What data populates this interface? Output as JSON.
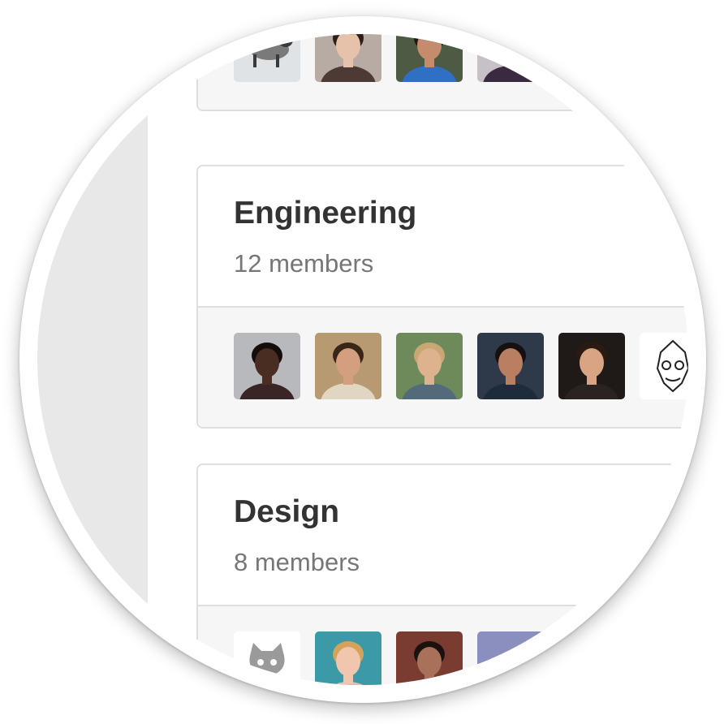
{
  "groups": [
    {
      "name": "",
      "members_label": "",
      "avatars": [
        {
          "icon": "cat-photo-avatar",
          "bg": "#dfe3e6",
          "skin": "#7a7a7a",
          "hair": "#3a3a3a",
          "shirt": "#c9ced2"
        },
        {
          "icon": "woman-photo-avatar",
          "bg": "#b8aba4",
          "skin": "#e7c2aa",
          "hair": "#2e1c16",
          "shirt": "#4d3a34"
        },
        {
          "icon": "bearded-man-photo-avatar",
          "bg": "#4d5a44",
          "skin": "#c48c6c",
          "hair": "#211611",
          "shirt": "#2f6fc4"
        },
        {
          "icon": "man-suit-photo-avatar",
          "bg": "#c7c0c6",
          "skin": "#d5ad96",
          "hair": "#1d1616",
          "shirt": "#3a2a3f"
        }
      ]
    },
    {
      "name": "Engineering",
      "members_label": "12 members",
      "avatars": [
        {
          "icon": "man-smiling-photo-avatar",
          "bg": "#b7b9bc",
          "skin": "#4a2d22",
          "hair": "#140d0a",
          "shirt": "#3a2426"
        },
        {
          "icon": "man-outdoor-photo-avatar",
          "bg": "#b89a72",
          "skin": "#d49f7f",
          "hair": "#3a2519",
          "shirt": "#e0d6c2"
        },
        {
          "icon": "woman-hat-photo-avatar",
          "bg": "#6f8a5a",
          "skin": "#dcb28f",
          "hair": "#c9a774",
          "shirt": "#516b7a"
        },
        {
          "icon": "woman-smiling-photo-avatar",
          "bg": "#2e3a4a",
          "skin": "#b97f62",
          "hair": "#171010",
          "shirt": "#1e2b3d"
        },
        {
          "icon": "man-dark-photo-avatar",
          "bg": "#1f1a18",
          "skin": "#d8a484",
          "hair": "#2a1a12",
          "shirt": "#2a2322"
        },
        {
          "icon": "mask-drawing-avatar",
          "bg": "#ffffff",
          "skin": "#ffffff",
          "hair": "#222222",
          "shirt": "#ffffff"
        }
      ]
    },
    {
      "name": "Design",
      "members_label": "8 members",
      "avatars": [
        {
          "icon": "octocat-avatar",
          "bg": "#ffffff",
          "skin": "#9a9a9a",
          "hair": "#6c6c6c",
          "shirt": "#ffffff"
        },
        {
          "icon": "woman-blonde-photo-avatar",
          "bg": "#3b9aa6",
          "skin": "#f0c7ae",
          "hair": "#d4a35a",
          "shirt": "#e3c0b2"
        },
        {
          "icon": "woman-glasses-photo-avatar",
          "bg": "#7a3b31",
          "skin": "#a9705a",
          "hair": "#1b1210",
          "shirt": "#5a2a24"
        },
        {
          "icon": "gradient-avatar",
          "bg": "#8b8fbf",
          "skin": "#8b8fbf",
          "hair": "#9aa8cf",
          "shirt": "#8b8fbf"
        }
      ]
    }
  ]
}
